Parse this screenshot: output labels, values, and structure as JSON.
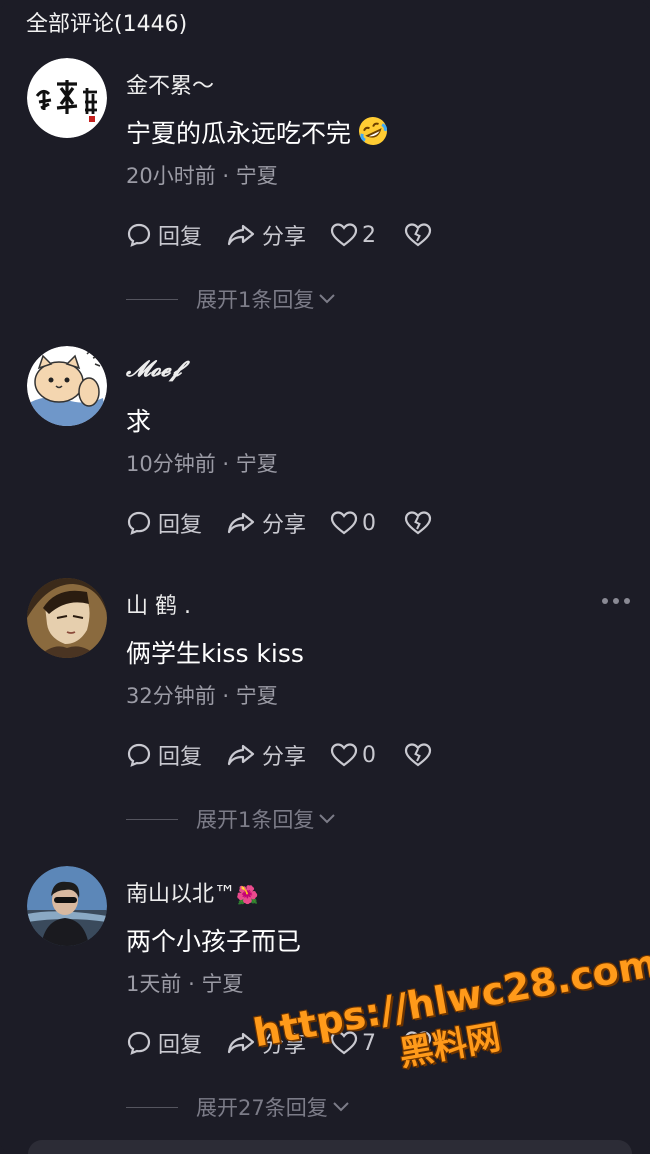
{
  "header": {
    "title": "全部评论(1446)"
  },
  "actions": {
    "reply_label": "回复",
    "share_label": "分享"
  },
  "comments": [
    {
      "name": "金不累～",
      "text": "宁夏的瓜永远吃不完",
      "text_emoji": "rolling-on-floor-laughing",
      "time": "20小时前",
      "location": "宁夏",
      "likes": "2",
      "expand": "展开1条回复",
      "avatar": "calligraphy-logo-avatar"
    },
    {
      "name": "𝓜𝓸𝓮𝓯",
      "text": "求",
      "time": "10分钟前",
      "location": "宁夏",
      "likes": "0",
      "avatar": "cartoon-cat-avatar"
    },
    {
      "name": "山 鹤 .",
      "text": "俩学生kiss kiss",
      "time": "32分钟前",
      "location": "宁夏",
      "likes": "0",
      "expand": "展开1条回复",
      "avatar": "anime-man-avatar"
    },
    {
      "name": "南山以北™",
      "name_emoji": "🌺",
      "text": "两个小孩子而已",
      "time": "1天前",
      "location": "宁夏",
      "likes": "7",
      "expand": "展开27条回复",
      "avatar": "photo-person-avatar"
    }
  ],
  "separator": "·",
  "watermark": {
    "url": "https://hlwc28.com",
    "name": "黑料网"
  },
  "colors": {
    "background": "#1c1c26",
    "text": "#ffffff",
    "meta": "#9b9ba5",
    "watermark": "#ff9a1a"
  }
}
